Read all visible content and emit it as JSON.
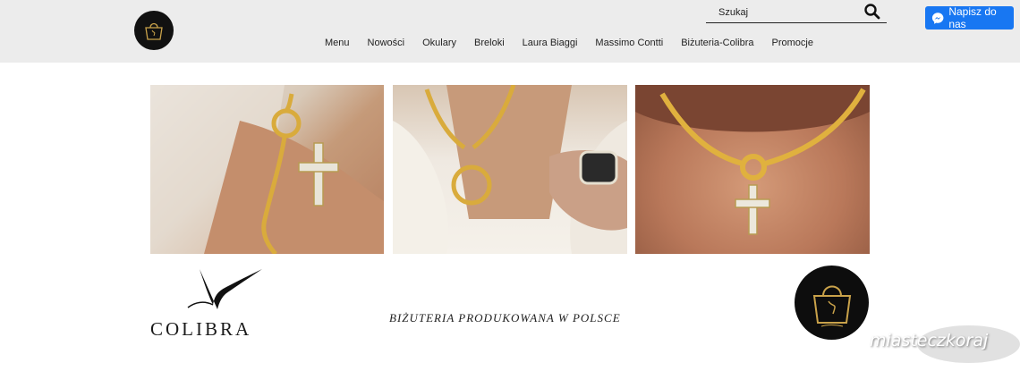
{
  "header": {
    "search": {
      "placeholder": "Szukaj",
      "value": ""
    },
    "nav": [
      "Menu",
      "Nowości",
      "Okulary",
      "Breloki",
      "Laura Biaggi",
      "Massimo Contti",
      "Biżuteria-Colibra",
      "Promocje"
    ],
    "messenger_label": "Napisz do nas"
  },
  "brand": {
    "name": "COLIBRA",
    "tagline": "BIŻUTERIA PRODUKOWANA W POLSCE"
  },
  "watermark": "miasteczkoraj",
  "colors": {
    "header_bg": "#ececec",
    "messenger": "#1877f2",
    "gold": "#d4a73a"
  }
}
